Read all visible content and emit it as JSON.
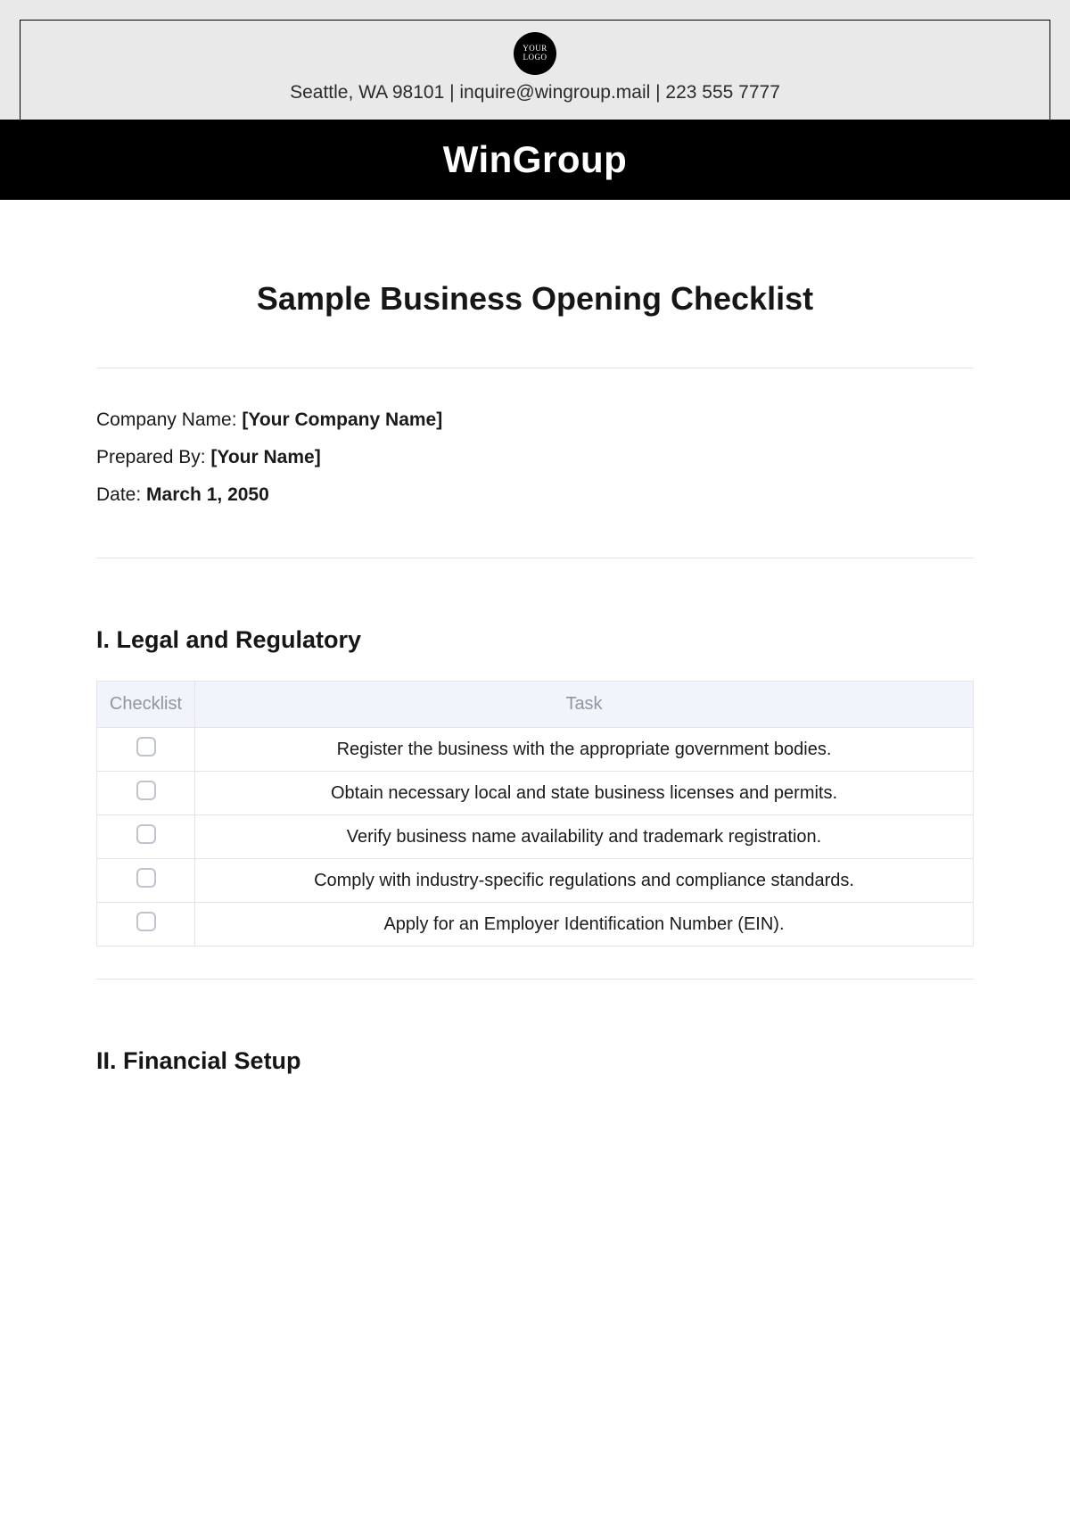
{
  "header": {
    "logo_text": "YOUR\nLOGO",
    "contact_line": "Seattle, WA 98101 | inquire@wingroup.mail | 223 555 7777",
    "brand": "WinGroup"
  },
  "doc_title": "Sample Business Opening Checklist",
  "meta": {
    "company_label": "Company Name: ",
    "company_value": "[Your Company Name]",
    "prepared_label": "Prepared By: ",
    "prepared_value": "[Your Name]",
    "date_label": "Date: ",
    "date_value": "March 1, 2050"
  },
  "sections": {
    "s1": {
      "title": "I. Legal and Regulatory",
      "col_checklist": "Checklist",
      "col_task": "Task",
      "tasks": [
        "Register the business with the appropriate government bodies.",
        "Obtain necessary local and state business licenses and permits.",
        "Verify business name availability and trademark registration.",
        "Comply with industry-specific regulations and compliance standards.",
        "Apply for an Employer Identification Number (EIN)."
      ]
    },
    "s2": {
      "title": "II. Financial Setup"
    }
  }
}
